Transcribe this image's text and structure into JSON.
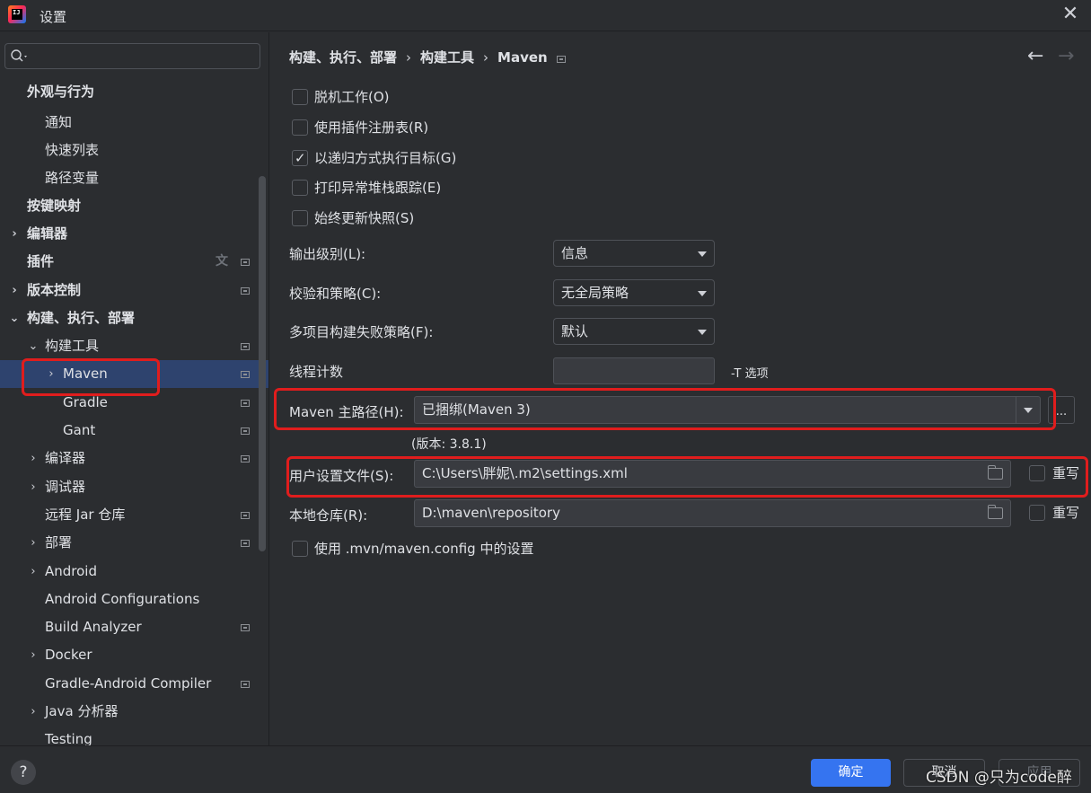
{
  "window": {
    "title": "设置"
  },
  "search": {
    "placeholder": ""
  },
  "sidebar": {
    "items": [
      {
        "label": "外观与行为",
        "expanded": null,
        "bold": true
      },
      {
        "label": "通知"
      },
      {
        "label": "快速列表"
      },
      {
        "label": "路径变量"
      },
      {
        "label": "按键映射",
        "bold": true
      },
      {
        "label": "编辑器",
        "bold": true
      },
      {
        "label": "插件",
        "bold": true
      },
      {
        "label": "版本控制",
        "bold": true
      },
      {
        "label": "构建、执行、部署",
        "bold": true
      },
      {
        "label": "构建工具"
      },
      {
        "label": "Maven"
      },
      {
        "label": "Gradle"
      },
      {
        "label": "Gant"
      },
      {
        "label": "编译器"
      },
      {
        "label": "调试器"
      },
      {
        "label": "远程 Jar 仓库"
      },
      {
        "label": "部署"
      },
      {
        "label": "Android"
      },
      {
        "label": "Android Configurations"
      },
      {
        "label": "Build Analyzer"
      },
      {
        "label": "Docker"
      },
      {
        "label": "Gradle-Android Compiler"
      },
      {
        "label": "Java 分析器"
      },
      {
        "label": "Testing"
      }
    ]
  },
  "breadcrumb": {
    "part1": "构建、执行、部署",
    "part2": "构建工具",
    "part3": "Maven"
  },
  "maven": {
    "checkboxes": [
      {
        "label": "脱机工作(O)",
        "checked": false
      },
      {
        "label": "使用插件注册表(R)",
        "checked": false
      },
      {
        "label": "以递归方式执行目标(G)",
        "checked": true
      },
      {
        "label": "打印异常堆栈跟踪(E)",
        "checked": false
      },
      {
        "label": "始终更新快照(S)",
        "checked": false
      }
    ],
    "output_level": {
      "label": "输出级别(L):",
      "value": "信息"
    },
    "checksum_policy": {
      "label": "校验和策略(C):",
      "value": "无全局策略"
    },
    "multiproject_fail": {
      "label": "多项目构建失败策略(F):",
      "value": "默认"
    },
    "thread_count": {
      "label": "线程计数",
      "value": "",
      "hint": "-T 选项"
    },
    "home_path": {
      "label": "Maven 主路径(H):",
      "value": "已捆绑(Maven 3)",
      "version": "(版本: 3.8.1)",
      "browse": "..."
    },
    "user_settings": {
      "label": "用户设置文件(S):",
      "value": "C:\\Users\\胖妮\\.m2\\settings.xml",
      "override": "重写",
      "override_checked": false
    },
    "local_repo": {
      "label": "本地仓库(R):",
      "value": "D:\\maven\\repository",
      "override": "重写",
      "override_checked": false
    },
    "use_mvn_config": {
      "label": "使用 .mvn/maven.config 中的设置",
      "checked": false
    }
  },
  "footer": {
    "help": "?",
    "ok": "确定",
    "cancel": "取消",
    "apply": "应用",
    "watermark": "CSDN @只为code醉"
  },
  "colors": {
    "background": "#2b2d30",
    "selection": "#2e436e",
    "accent": "#3574f0",
    "highlight_box": "#e01d1d"
  }
}
